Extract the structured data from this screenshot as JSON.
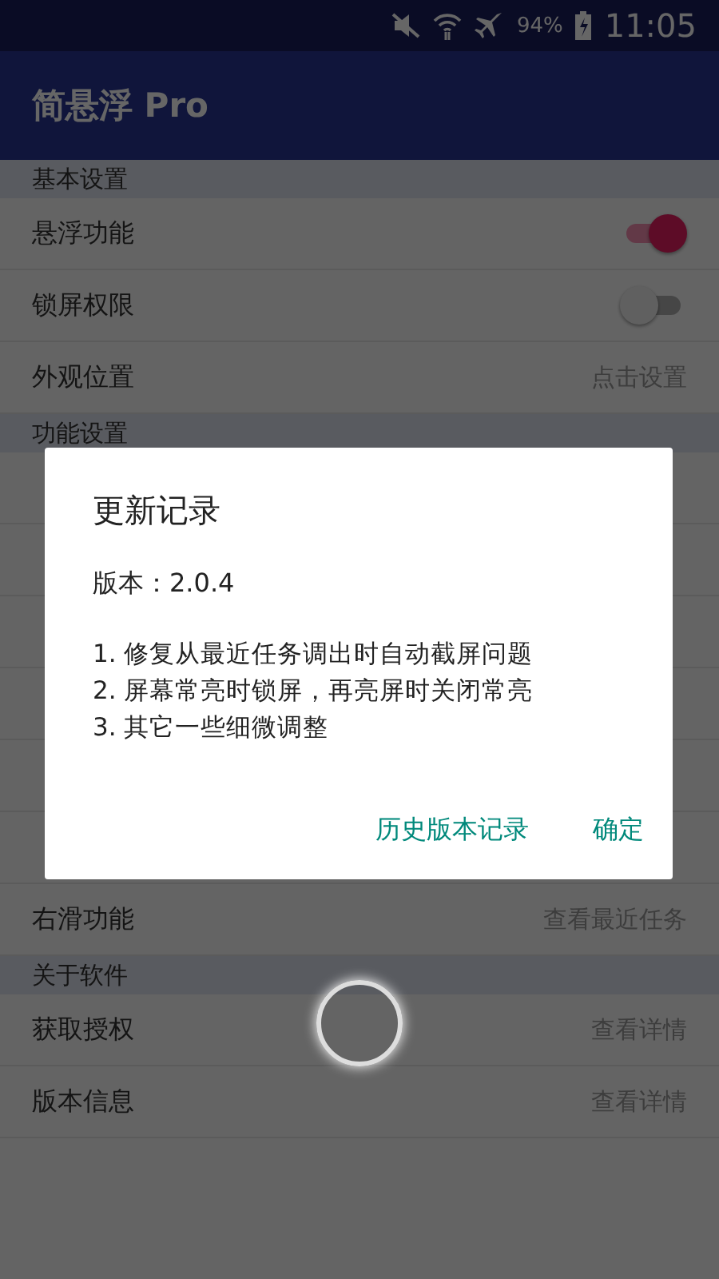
{
  "status_bar": {
    "battery": "94%",
    "time": "11:05"
  },
  "app_bar": {
    "title": "简悬浮 Pro"
  },
  "settings": [
    {
      "kind": "section",
      "label": "基本设置"
    },
    {
      "kind": "toggle",
      "label": "悬浮功能",
      "on": true
    },
    {
      "kind": "toggle",
      "label": "锁屏权限",
      "on": false
    },
    {
      "kind": "value",
      "label": "外观位置",
      "value": "点击设置"
    },
    {
      "kind": "section",
      "label": "功能设置"
    },
    {
      "kind": "blank"
    },
    {
      "kind": "blank"
    },
    {
      "kind": "blank"
    },
    {
      "kind": "blank"
    },
    {
      "kind": "blank"
    },
    {
      "kind": "blank"
    },
    {
      "kind": "value",
      "label": "右滑功能",
      "value": "查看最近任务"
    },
    {
      "kind": "section",
      "label": "关于软件"
    },
    {
      "kind": "value",
      "label": "获取授权",
      "value": "查看详情"
    },
    {
      "kind": "value",
      "label": "版本信息",
      "value": "查看详情"
    }
  ],
  "dialog": {
    "title": "更新记录",
    "version": "版本：2.0.4",
    "notes": [
      "1. 修复从最近任务调出时自动截屏问题",
      "2. 屏幕常亮时锁屏，再亮屏时关闭常亮",
      "3. 其它一些细微调整"
    ],
    "buttons": [
      "历史版本记录",
      "确定"
    ]
  }
}
